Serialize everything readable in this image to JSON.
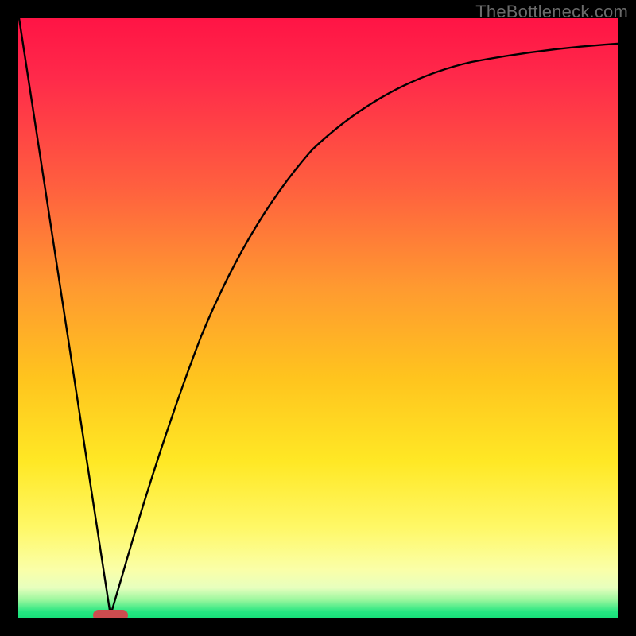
{
  "watermark": "TheBottleneck.com",
  "colors": {
    "frame": "#000000",
    "curve": "#000000",
    "marker_fill": "#cc4c4f",
    "gradient_top": "#ff1445",
    "gradient_bottom": "#18e07a"
  },
  "chart_data": {
    "type": "line",
    "title": "",
    "xlabel": "",
    "ylabel": "",
    "xlim": [
      0,
      100
    ],
    "ylim": [
      0,
      100
    ],
    "grid": false,
    "legend": false,
    "series": [
      {
        "name": "left-line",
        "x": [
          0,
          15
        ],
        "values": [
          100,
          0
        ]
      },
      {
        "name": "right-curve",
        "x": [
          15,
          20,
          25,
          30,
          35,
          40,
          45,
          50,
          55,
          60,
          65,
          70,
          75,
          80,
          85,
          90,
          95,
          100
        ],
        "values": [
          0,
          20,
          36,
          48,
          58,
          66,
          72,
          77,
          81,
          84,
          86.5,
          88.5,
          90,
          91.2,
          92.2,
          93,
          93.7,
          94.3
        ]
      }
    ],
    "marker": {
      "shape": "capsule",
      "x_center": 15,
      "y_center": 0,
      "width": 6,
      "height": 2
    }
  }
}
